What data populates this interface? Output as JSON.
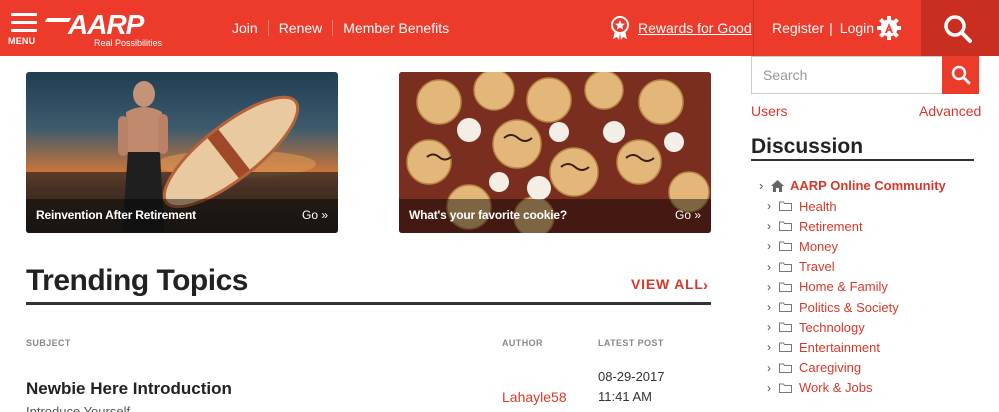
{
  "header": {
    "menu_label": "MENU",
    "logo_text": "AARP",
    "logo_tagline": "Real Possibilities",
    "nav": [
      {
        "label": "Join"
      },
      {
        "label": "Renew"
      },
      {
        "label": "Member Benefits"
      }
    ],
    "rewards_label": "Rewards for Good",
    "register_label": "Register",
    "separator": "|",
    "login_label": "Login"
  },
  "tiles": [
    {
      "title": "Reinvention After Retirement",
      "go": "Go »"
    },
    {
      "title": "What's your favorite cookie?",
      "go": "Go »"
    }
  ],
  "trending": {
    "title": "Trending Topics",
    "view_all": "VIEW ALL",
    "view_all_arrow": "›",
    "columns": {
      "subject": "SUBJECT",
      "author": "AUTHOR",
      "latest_post": "LATEST POST"
    },
    "rows": [
      {
        "subject": "Newbie Here Introduction",
        "description": "Introduce Yourself",
        "author": "Lahayle58",
        "date": "08-29-2017",
        "time": "11:41 AM"
      }
    ]
  },
  "sidebar": {
    "search_placeholder": "Search",
    "users_link": "Users",
    "advanced_link": "Advanced",
    "discussion_title": "Discussion",
    "root_label": "AARP Online Community",
    "categories": [
      {
        "label": "Health"
      },
      {
        "label": "Retirement"
      },
      {
        "label": "Money"
      },
      {
        "label": "Travel"
      },
      {
        "label": "Home & Family"
      },
      {
        "label": "Politics & Society"
      },
      {
        "label": "Technology"
      },
      {
        "label": "Entertainment"
      },
      {
        "label": "Caregiving"
      },
      {
        "label": "Work & Jobs"
      }
    ]
  },
  "colors": {
    "brand_red": "#ec3a2b",
    "link_red": "#d8382b",
    "dark_red": "#c92e21"
  },
  "icons": {
    "menu": "hamburger-icon",
    "rewards": "ribbon-star-icon",
    "login": "gear-a-icon",
    "search": "search-icon",
    "home": "home-icon",
    "folder": "folder-icon",
    "chevron": "chevron-right-icon"
  }
}
